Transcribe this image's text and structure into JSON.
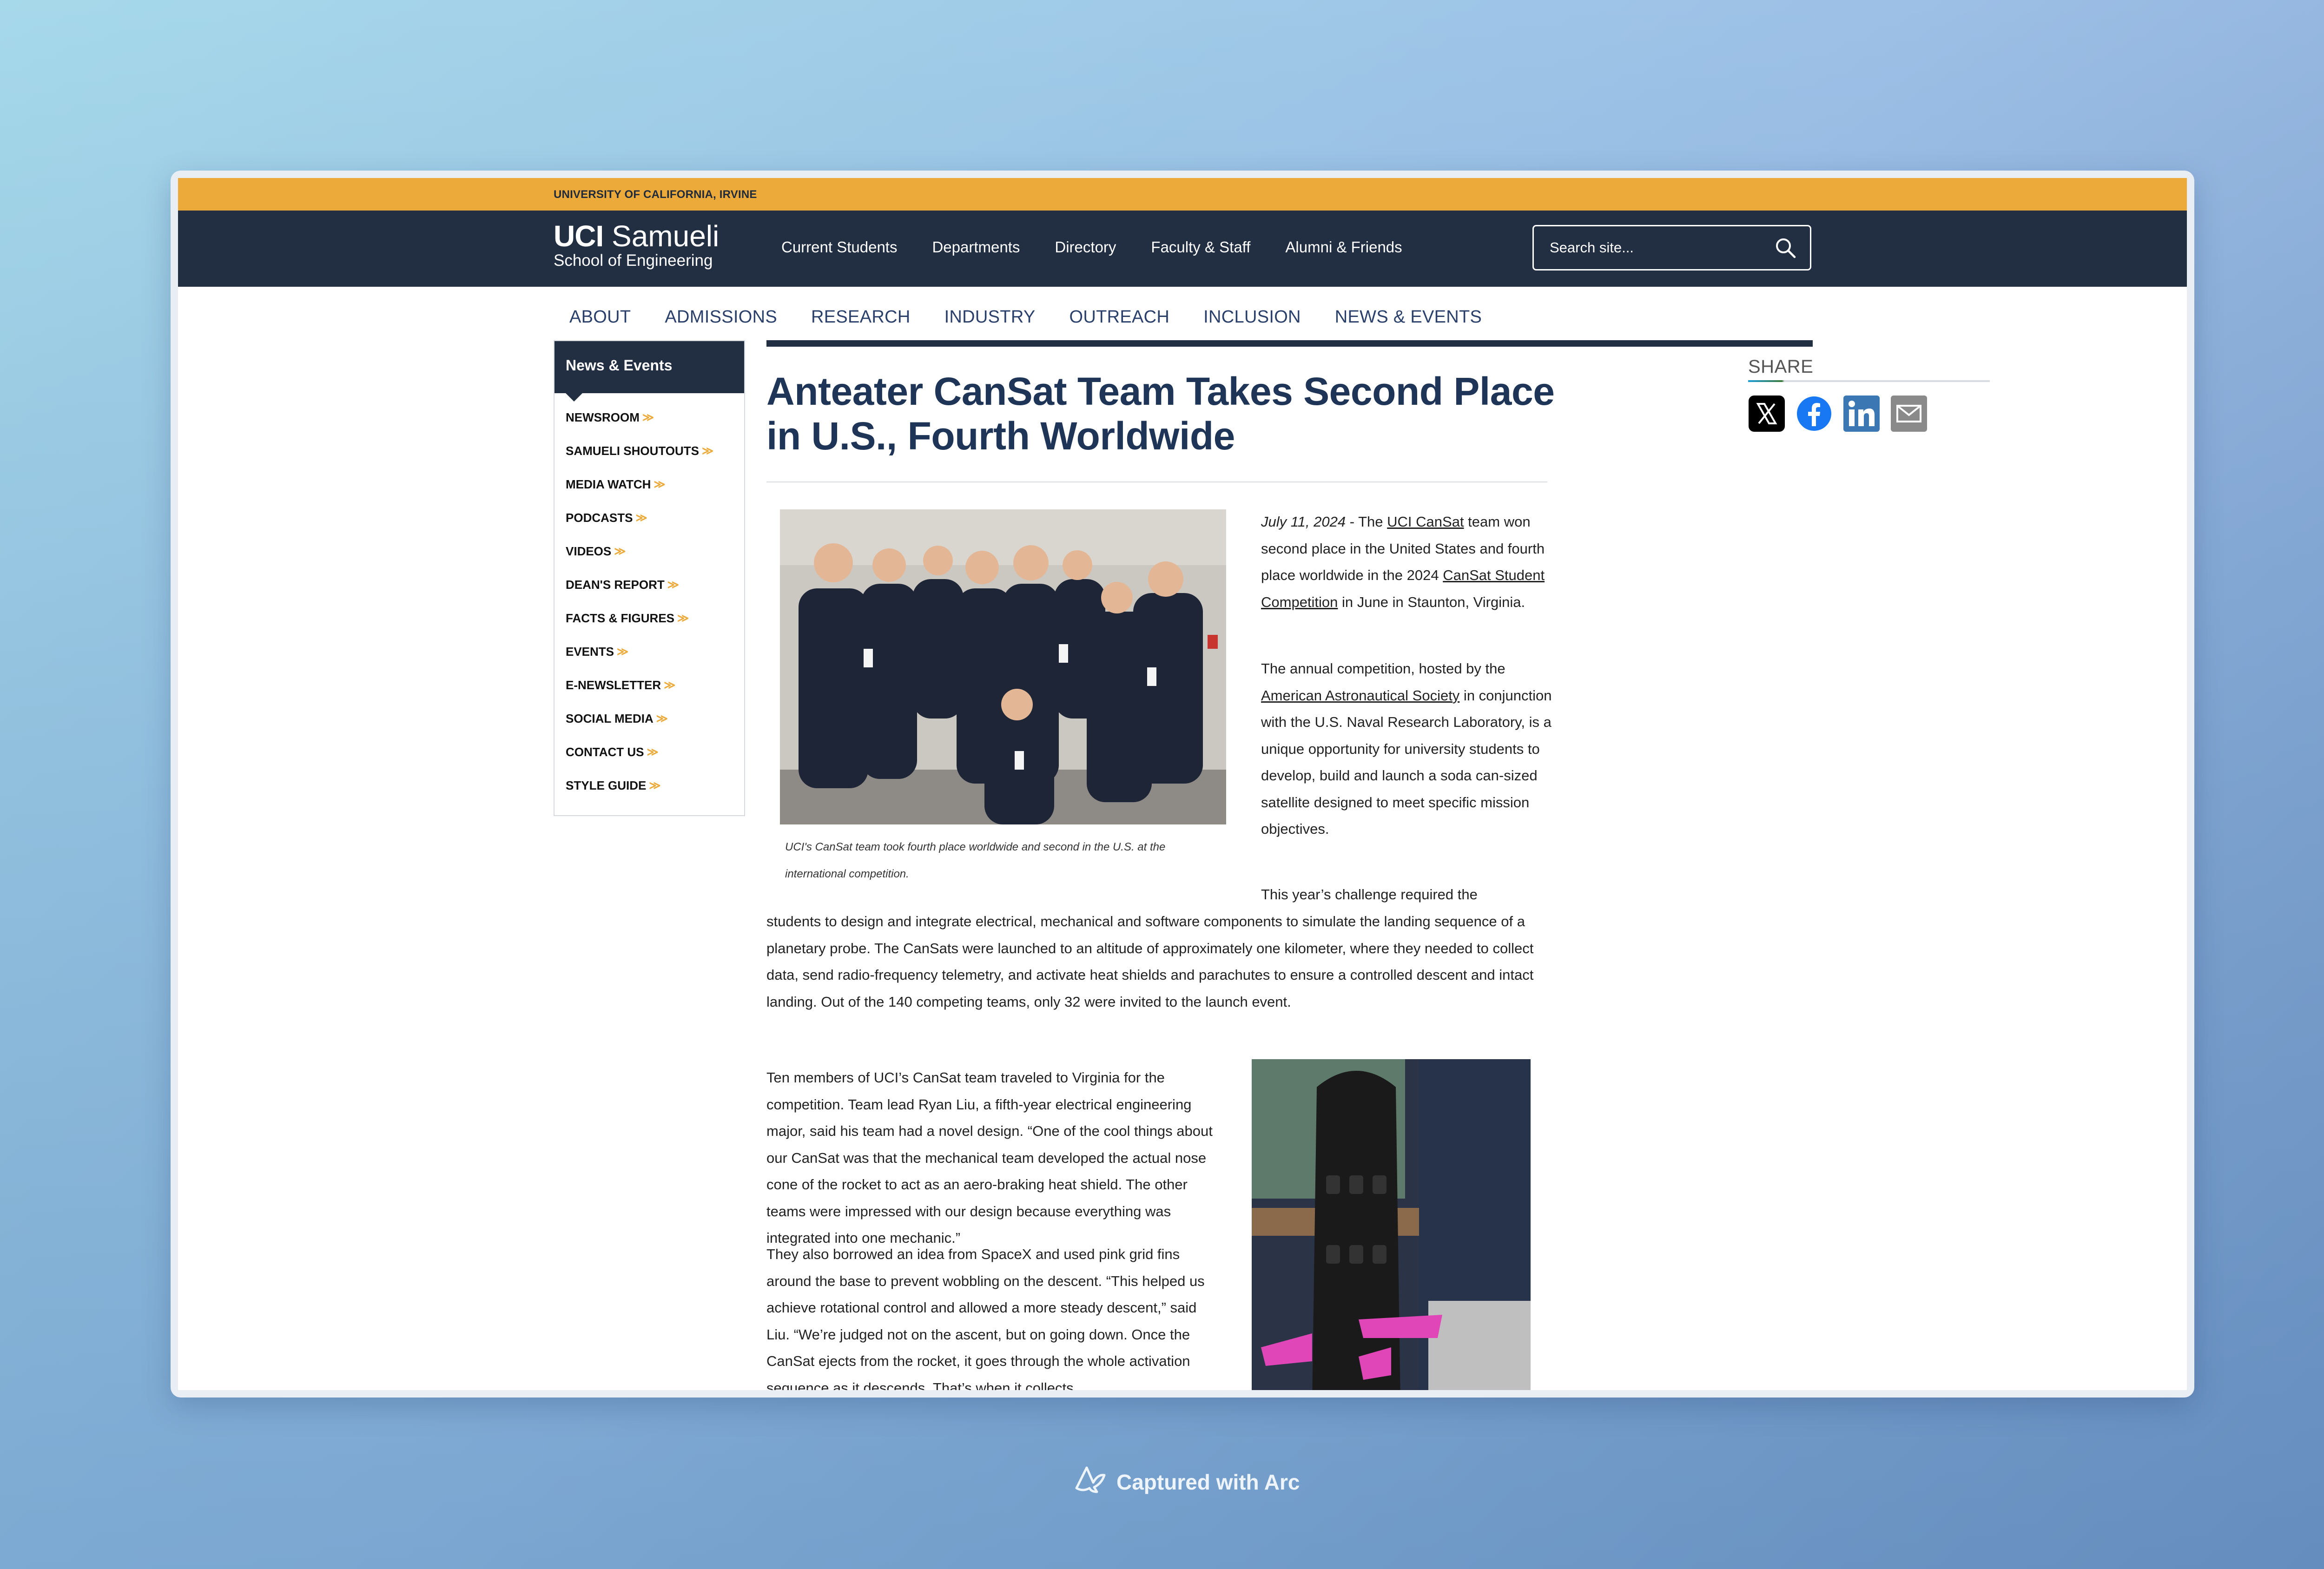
{
  "top_bar": {
    "text": "UNIVERSITY OF CALIFORNIA, IRVINE"
  },
  "logo": {
    "brand": "UCI",
    "name": "Samueli",
    "subtitle": "School of Engineering"
  },
  "top_nav": [
    "Current Students",
    "Departments",
    "Directory",
    "Faculty & Staff",
    "Alumni & Friends"
  ],
  "search": {
    "placeholder": "Search site..."
  },
  "section_nav": [
    "ABOUT",
    "ADMISSIONS",
    "RESEARCH",
    "INDUSTRY",
    "OUTREACH",
    "INCLUSION",
    "NEWS & EVENTS"
  ],
  "sidebar": {
    "heading": "News & Events",
    "items": [
      "NEWSROOM",
      "SAMUELI SHOUTOUTS",
      "MEDIA WATCH",
      "PODCASTS",
      "VIDEOS",
      "DEAN'S REPORT",
      "FACTS & FIGURES",
      "EVENTS",
      "E-NEWSLETTER",
      "SOCIAL MEDIA",
      "CONTACT US",
      "STYLE GUIDE"
    ],
    "chevron": "≫"
  },
  "article": {
    "title": "Anteater CanSat Team Takes Second Place in U.S., Fourth Worldwide",
    "date": "July 11, 2024",
    "p1_a": " - The ",
    "link_cansat": "UCI CanSat",
    "p1_b": " team won second place in the United States and fourth place worldwide in the 2024 ",
    "link_competition": "CanSat Student Competition",
    "p1_c": " in June in Staunton, Virginia.",
    "p2_a": "The annual competition, hosted by the ",
    "link_aas": "American Astronautical Society",
    "p2_b": " in conjunction with the U.S. Naval Research Laboratory, is a unique opportunity for university students to develop, build and launch a soda can-sized satellite designed to meet specific mission objectives.",
    "p3_a": "This year’s challenge required the",
    "p3_b": "students to design and integrate electrical, mechanical and software components to simulate the landing sequence of a planetary probe. The CanSats were launched to an altitude of approximately one kilometer, where they needed to collect data, send radio-frequency telemetry, and activate heat shields and parachutes to ensure a controlled descent and intact landing. Out of the 140 competing teams, only 32 were invited to the launch event.",
    "p4": "Ten members of UCI’s CanSat team traveled to Virginia for the competition. Team lead Ryan Liu, a fifth-year electrical engineering major, said his team had a novel design. “One of the cool things about our CanSat was that the mechanical team developed the actual nose cone of the rocket to act as an aero-braking heat shield. The other teams were impressed with our design because everything was integrated into one mechanic.”",
    "p5": "They also borrowed an idea from SpaceX and used pink grid fins around the base to prevent wobbling on the descent. “This helped us achieve rotational control and allowed a more steady descent,” said Liu. “We’re judged not on the ascent, but on going down. Once the CanSat ejects from the rocket, it goes through the whole activation sequence as it descends. That’s when it collects",
    "caption": "UCI's CanSat team took fourth place worldwide and second in the U.S. at the international competition."
  },
  "share": {
    "title": "SHARE",
    "icons": [
      "x-icon",
      "facebook-icon",
      "linkedin-icon",
      "email-icon"
    ]
  },
  "footer": {
    "text": "Captured with Arc"
  },
  "colors": {
    "gold": "#ecaa3a",
    "navy": "#222f42",
    "title": "#1e3557",
    "link_nav": "#2a3f6a"
  }
}
